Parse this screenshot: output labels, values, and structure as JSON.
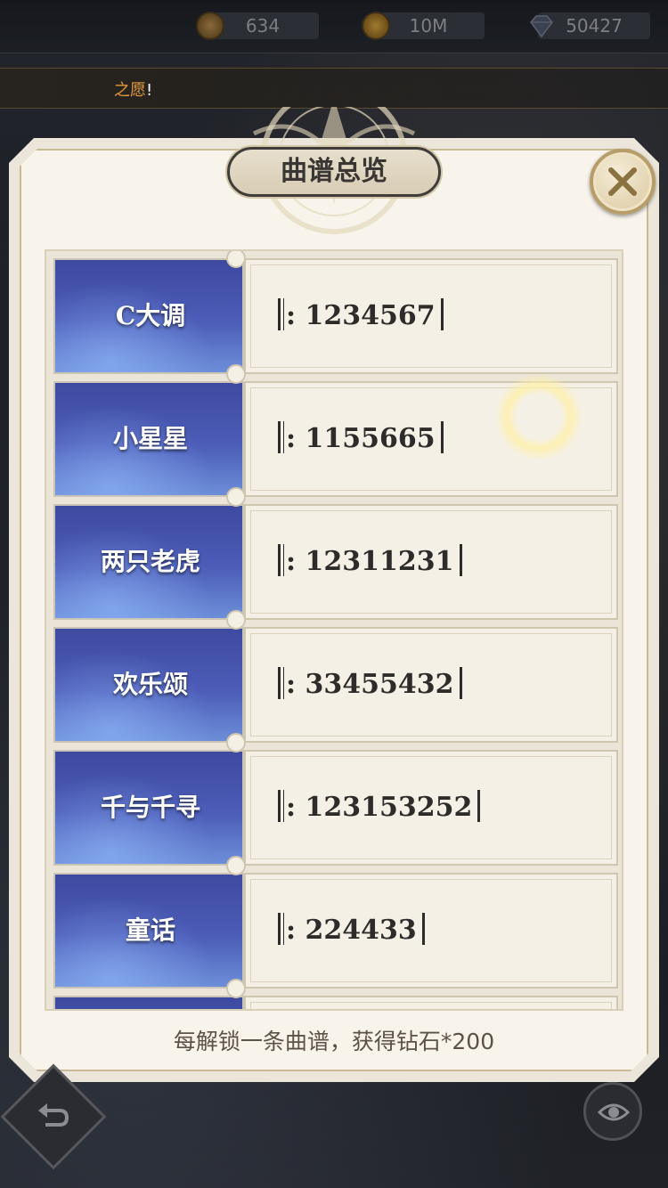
{
  "currency": {
    "item1": {
      "icon": "coin-icon",
      "value": "634"
    },
    "item2": {
      "icon": "gold-coin-icon",
      "value": "10M"
    },
    "item3": {
      "icon": "diamond-icon",
      "value": "50427"
    }
  },
  "banner": {
    "text": "之愿",
    "excl": "!"
  },
  "modal": {
    "title": "曲谱总览",
    "close_icon": "close-icon",
    "songs": [
      {
        "name": "C大调",
        "score": "1234567"
      },
      {
        "name": "小星星",
        "score": "1155665"
      },
      {
        "name": "两只老虎",
        "score": "12311231"
      },
      {
        "name": "欢乐颂",
        "score": "33455432"
      },
      {
        "name": "千与千寻",
        "score": "123153252"
      },
      {
        "name": "童话",
        "score": "224433"
      }
    ],
    "footer": "每解锁一条曲谱，获得钻石*200"
  },
  "controls": {
    "back_icon": "back-arrow-icon",
    "eye_icon": "eye-icon"
  },
  "colors": {
    "accent": "#e29a3a",
    "row_blue": "#4c5cb8",
    "frame": "#c9b994"
  }
}
